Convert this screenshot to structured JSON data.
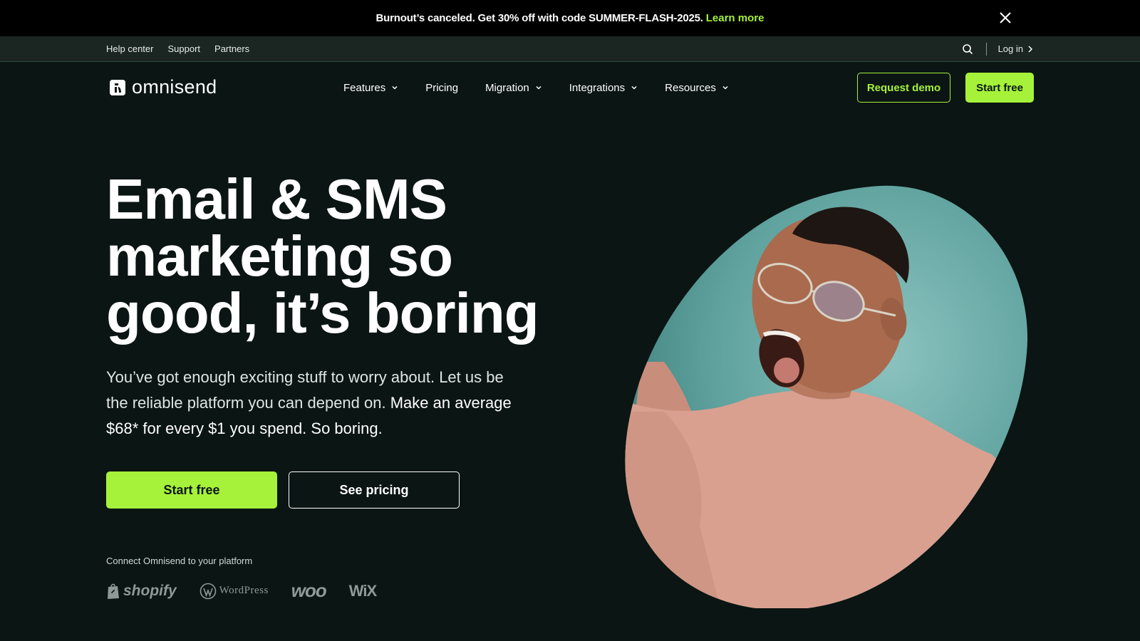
{
  "promo": {
    "text": "Burnout’s canceled. Get 30% off with code SUMMER-FLASH-2025.",
    "link": "Learn more"
  },
  "utility": {
    "links": [
      "Help center",
      "Support",
      "Partners"
    ],
    "login": "Log in"
  },
  "nav": {
    "logo": "omnisend",
    "items": [
      {
        "label": "Features",
        "dropdown": true
      },
      {
        "label": "Pricing",
        "dropdown": false
      },
      {
        "label": "Migration",
        "dropdown": true
      },
      {
        "label": "Integrations",
        "dropdown": true
      },
      {
        "label": "Resources",
        "dropdown": true
      }
    ],
    "request_demo": "Request demo",
    "start_free": "Start free"
  },
  "hero": {
    "headline": [
      "Email & SMS",
      "marketing so",
      "good, it’s boring"
    ],
    "sub_light": "You’ve got enough exciting stuff to worry about. Let us be the reliable platform you can depend on.",
    "sub_strong": "Make an average $68* for every $1 you spend. So boring.",
    "start_free": "Start free",
    "see_pricing": "See pricing",
    "connect_label": "Connect Omnisend to your platform",
    "platforms": [
      "shopify",
      "WordPress",
      "woo",
      "WiX"
    ]
  },
  "colors": {
    "accent": "#a6f23a",
    "background": "#0b1513",
    "photo_bg": "#5fa8a4",
    "sweater": "#d9a090"
  },
  "icons": {
    "close": "close-icon",
    "search": "search-icon",
    "login_arrow": "chevron-right-icon",
    "dropdown": "chevron-down-icon"
  }
}
